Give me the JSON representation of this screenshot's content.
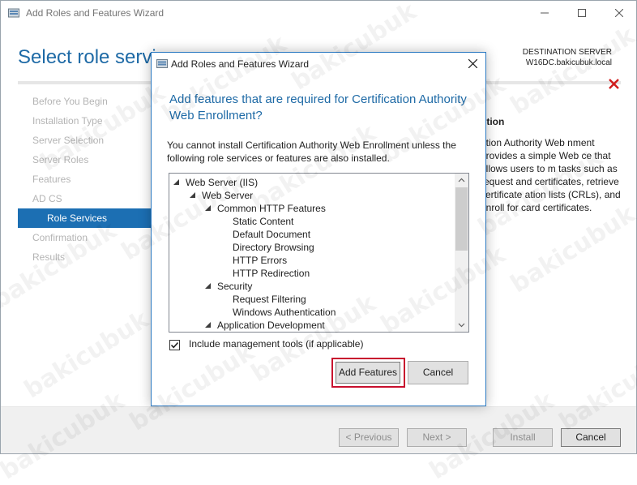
{
  "main_window": {
    "title": "Add Roles and Features Wizard",
    "page_title": "Select role servic",
    "destination_label": "DESTINATION SERVER",
    "destination_server": "W16DC.bakicubuk.local",
    "nav": [
      {
        "label": "Before You Begin",
        "active": false
      },
      {
        "label": "Installation Type",
        "active": false
      },
      {
        "label": "Server Selection",
        "active": false
      },
      {
        "label": "Server Roles",
        "active": false
      },
      {
        "label": "Features",
        "active": false
      },
      {
        "label": "AD CS",
        "active": false
      },
      {
        "label": "Role Services",
        "active": true
      },
      {
        "label": "Confirmation",
        "active": false
      },
      {
        "label": "Results",
        "active": false
      }
    ],
    "description_heading": "ption",
    "description_text": "ation Authority Web nment provides a simple Web ce that allows users to m tasks such as request and certificates, retrieve certificate ation lists (CRLs), and enroll for card certificates.",
    "footer": {
      "previous": "< Previous",
      "next": "Next >",
      "install": "Install",
      "cancel": "Cancel"
    }
  },
  "dialog": {
    "title": "Add Roles and Features Wizard",
    "heading": "Add features that are required for Certification Authority Web Enrollment?",
    "body": "You cannot install Certification Authority Web Enrollment unless the following role services or features are also installed.",
    "tree": [
      {
        "label": "Web Server (IIS)",
        "level": 0,
        "expanded": true
      },
      {
        "label": "Web Server",
        "level": 1,
        "expanded": true
      },
      {
        "label": "Common HTTP Features",
        "level": 2,
        "expanded": true
      },
      {
        "label": "Static Content",
        "level": 3,
        "expanded": null
      },
      {
        "label": "Default Document",
        "level": 3,
        "expanded": null
      },
      {
        "label": "Directory Browsing",
        "level": 3,
        "expanded": null
      },
      {
        "label": "HTTP Errors",
        "level": 3,
        "expanded": null
      },
      {
        "label": "HTTP Redirection",
        "level": 3,
        "expanded": null
      },
      {
        "label": "Security",
        "level": 2,
        "expanded": true
      },
      {
        "label": "Request Filtering",
        "level": 3,
        "expanded": null
      },
      {
        "label": "Windows Authentication",
        "level": 3,
        "expanded": null
      },
      {
        "label": "Application Development",
        "level": 2,
        "expanded": true
      }
    ],
    "include_tools_label": "Include management tools (if applicable)",
    "include_tools_checked": true,
    "add_features_button": "Add Features",
    "cancel_button": "Cancel"
  },
  "watermark": "bakicubuk",
  "colors": {
    "accent_blue": "#1e6aa6",
    "nav_active": "#1c6fb3",
    "highlight_red": "#c8102e",
    "error_red": "#d01c1c"
  }
}
